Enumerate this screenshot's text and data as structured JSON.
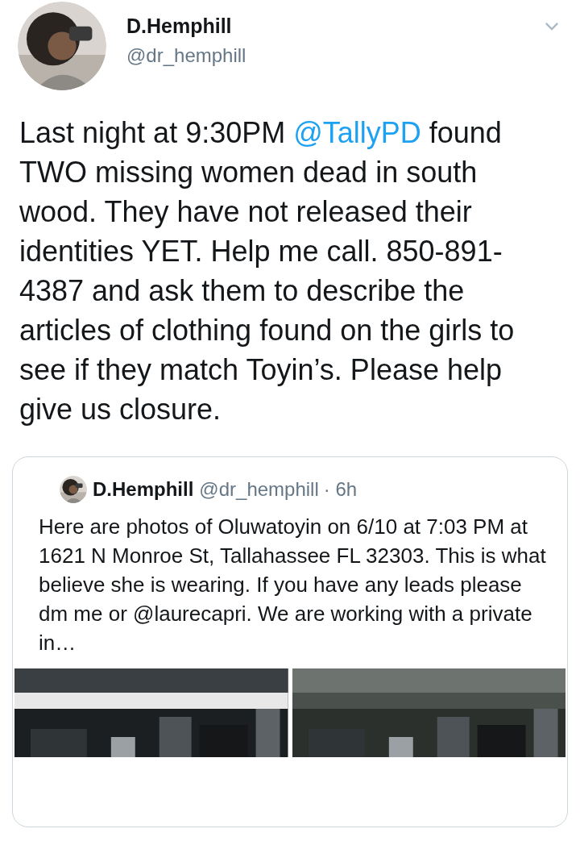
{
  "tweet": {
    "author": {
      "name": "D.Hemphill",
      "handle": "@dr_hemphill"
    },
    "body": [
      {
        "kind": "text",
        "text": "Last night at 9:30PM "
      },
      {
        "kind": "mention",
        "text": "@TallyPD"
      },
      {
        "kind": "text",
        "text": " found TWO missing women dead in south wood. They have not released their identities YET. Help me call. 850-891-4387 and ask them to describe the articles of clothing found on the girls to see if they match Toyin’s. Please help give us closure."
      }
    ],
    "quoted": {
      "name": "D.Hemphill",
      "handle": "@dr_hemphill",
      "time": "· 6h",
      "text": "Here are photos of Oluwatoyin on 6/10 at 7:03 PM at 1621 N Monroe St, Tallahassee FL 32303. This is what believe she is wearing. If you have any leads please dm me or @laurecapri. We are working with a private in…"
    }
  }
}
